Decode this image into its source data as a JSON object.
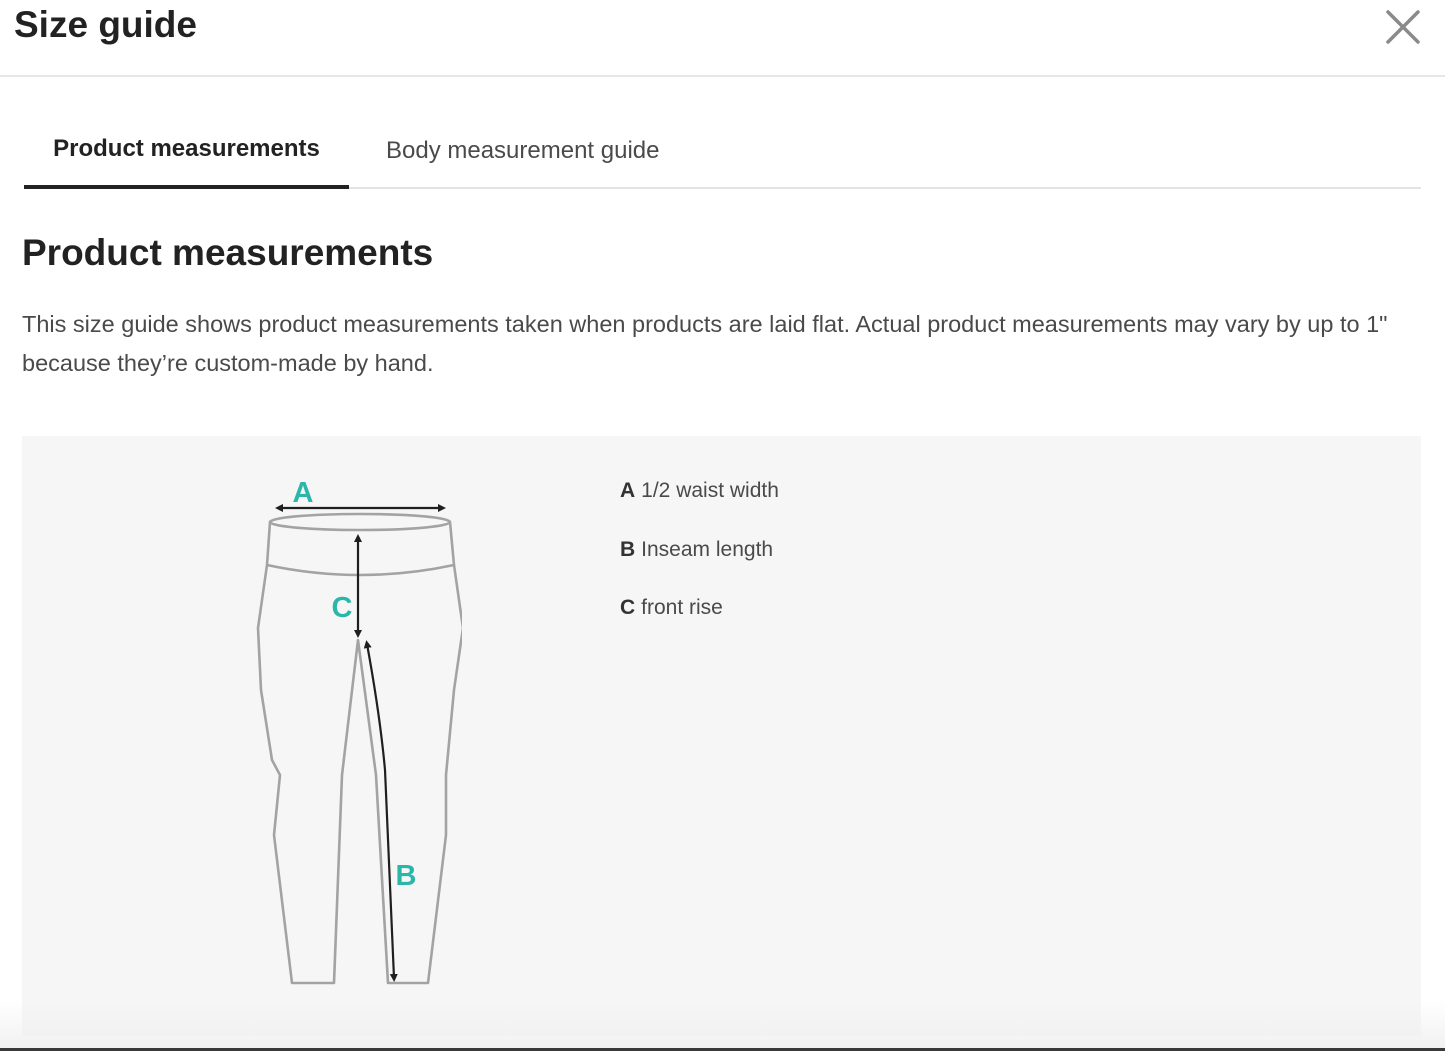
{
  "header": {
    "title": "Size guide",
    "close_icon": "close-icon"
  },
  "tabs": [
    {
      "label": "Product measurements",
      "active": true
    },
    {
      "label": "Body measurement guide",
      "active": false
    }
  ],
  "section": {
    "title": "Product measurements",
    "description": "This size guide shows product measurements taken when products are laid flat. Actual product measurements may vary by up to 1\" because they’re custom-made by hand."
  },
  "diagram": {
    "illustration": "leggings-measurement-illustration",
    "labels": {
      "a": "A",
      "b": "B",
      "c": "C"
    },
    "label_color": "#2ab7aa"
  },
  "legend": [
    {
      "key": "A",
      "text": "1/2 waist width"
    },
    {
      "key": "B",
      "text": "Inseam length"
    },
    {
      "key": "C",
      "text": "front rise"
    }
  ],
  "colors": {
    "accent": "#2ab7aa",
    "text_primary": "#222222",
    "text_secondary": "#4a4a4a",
    "panel_background": "#f6f6f6"
  }
}
